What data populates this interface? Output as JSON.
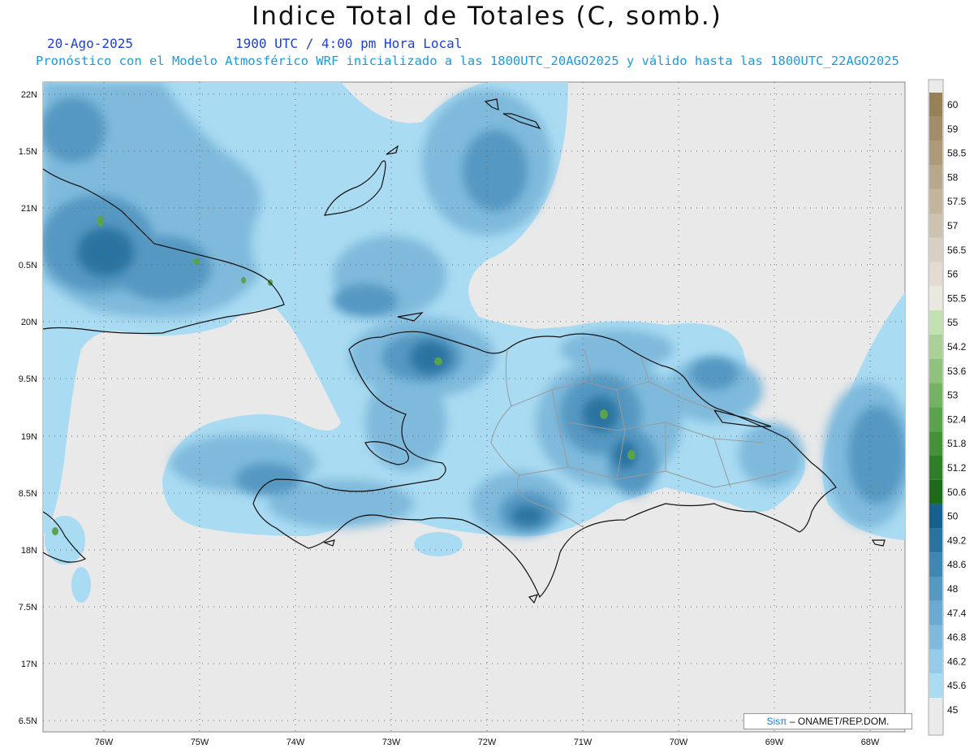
{
  "header": {
    "title": "Indice Total de Totales (C, somb.)",
    "date": "20-Ago-2025",
    "time": "1900 UTC / 4:00 pm Hora Local",
    "model_info": "Pronóstico con el Modelo Atmosférico WRF inicializado a las 1800UTC_20AGO2025 y válido hasta las  1800UTC_22AGO2025"
  },
  "axes": {
    "lat_labels": [
      "22N",
      "1.5N",
      "21N",
      "0.5N",
      "20N",
      "9.5N",
      "19N",
      "8.5N",
      "18N",
      "7.5N",
      "17N",
      "6.5N"
    ],
    "lon_labels": [
      "76W",
      "75W",
      "74W",
      "73W",
      "72W",
      "71W",
      "70W",
      "69W",
      "68W"
    ]
  },
  "colorbar": {
    "levels": [
      "60",
      "59",
      "58.5",
      "58",
      "57.5",
      "57",
      "56.5",
      "56",
      "55.5",
      "55",
      "54.2",
      "53.6",
      "53",
      "52.4",
      "51.8",
      "51.2",
      "50.6",
      "50",
      "49.2",
      "48.6",
      "48",
      "47.4",
      "46.8",
      "46.2",
      "45.6",
      "45"
    ],
    "colors": [
      "#968156",
      "#a18d67",
      "#ac9a78",
      "#b8a88b",
      "#c3b59d",
      "#cec3b0",
      "#d8d0c2",
      "#e1dbd1",
      "#ebe8e1",
      "#c2e0b0",
      "#a9d195",
      "#8fc27c",
      "#74b263",
      "#5ba24c",
      "#449137",
      "#2f7f28",
      "#1d6a1b",
      "#175f8e",
      "#2a73a0",
      "#3f86b2",
      "#5598c2",
      "#6aaad0",
      "#7fbadc",
      "#94cbe8",
      "#a9dbf2",
      "#ffffff"
    ]
  },
  "credit": {
    "sis": "Sisπ",
    "org": " – ONAMET/REP.DOM."
  },
  "palette": {
    "background": "#e9e9e9",
    "coast": "#111111",
    "provinces": "#9a9a9a",
    "grid": "#555555"
  }
}
